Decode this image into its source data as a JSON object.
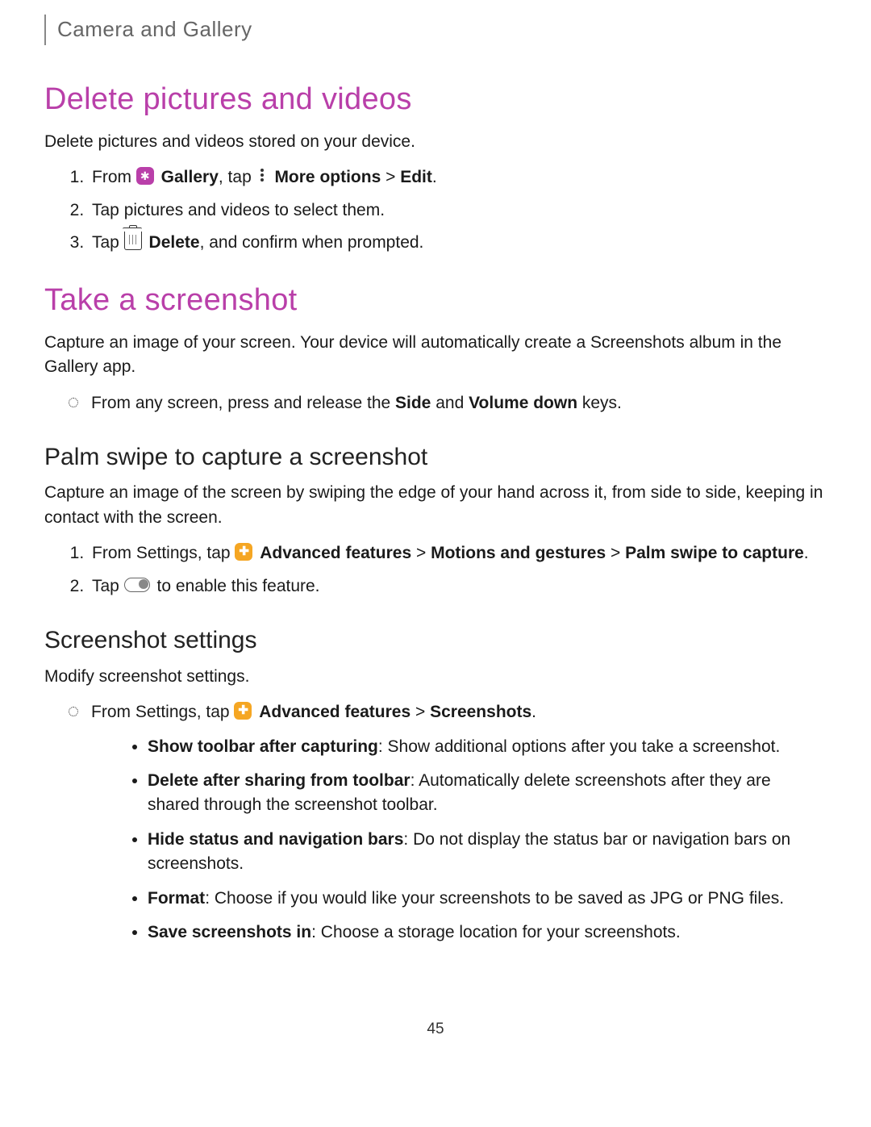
{
  "breadcrumb": "Camera and Gallery",
  "section1": {
    "title": "Delete pictures and videos",
    "intro": "Delete pictures and videos stored on your device.",
    "step1_a": "From ",
    "step1_gallery": "Gallery",
    "step1_b": ", tap ",
    "step1_more": "More options",
    "step1_c": " > ",
    "step1_edit": "Edit",
    "step1_d": ".",
    "step2": "Tap pictures and videos to select them.",
    "step3_a": "Tap ",
    "step3_delete": "Delete",
    "step3_b": ", and confirm when prompted."
  },
  "section2": {
    "title": "Take a screenshot",
    "intro": "Capture an image of your screen. Your device will automatically create a Screenshots album in the Gallery app.",
    "bullet_a": "From any screen, press and release the ",
    "bullet_side": "Side",
    "bullet_b": " and ",
    "bullet_vol": "Volume down",
    "bullet_c": " keys."
  },
  "section3": {
    "title": "Palm swipe to capture a screenshot",
    "intro": "Capture an image of the screen by swiping the edge of your hand across it, from side to side, keeping in contact with the screen.",
    "step1_a": "From Settings, tap ",
    "step1_adv": "Advanced features",
    "step1_b": " > ",
    "step1_motions": "Motions and gestures",
    "step1_c": " > ",
    "step1_palm": "Palm swipe to capture",
    "step1_d": ".",
    "step2_a": "Tap ",
    "step2_b": " to enable this feature."
  },
  "section4": {
    "title": "Screenshot settings",
    "intro": "Modify screenshot settings.",
    "bullet_a": "From Settings, tap ",
    "bullet_adv": "Advanced features",
    "bullet_b": " > ",
    "bullet_ss": "Screenshots",
    "bullet_c": ".",
    "opts": [
      {
        "label": "Show toolbar after capturing",
        "desc": ": Show additional options after you take a screenshot."
      },
      {
        "label": "Delete after sharing from toolbar",
        "desc": ": Automatically delete screenshots after they are shared through the screenshot toolbar."
      },
      {
        "label": "Hide status and navigation bars",
        "desc": ": Do not display the status bar or navigation bars on screenshots."
      },
      {
        "label": "Format",
        "desc": ": Choose if you would like your screenshots to be saved as JPG or PNG files."
      },
      {
        "label": "Save screenshots in",
        "desc": ": Choose a storage location for your screenshots."
      }
    ]
  },
  "pageNumber": "45"
}
